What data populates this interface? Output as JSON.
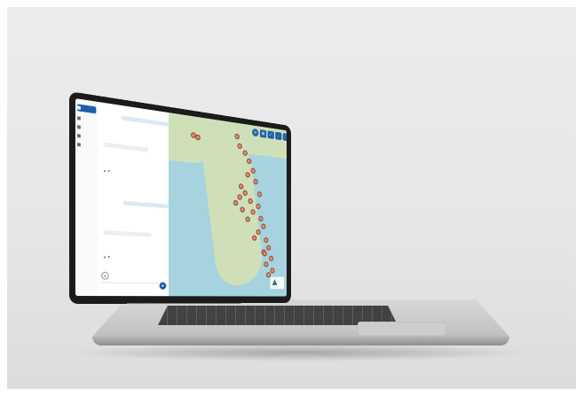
{
  "sidebar": {
    "items": [
      {
        "label": "",
        "icon": "chat-icon",
        "active": true
      },
      {
        "label": "",
        "icon": "history-icon",
        "active": false
      },
      {
        "label": "",
        "icon": "users-icon",
        "active": false
      },
      {
        "label": "",
        "icon": "settings-icon",
        "active": false
      },
      {
        "label": "",
        "icon": "help-icon",
        "active": false
      }
    ]
  },
  "chat": {
    "messages": [
      {
        "role": "user",
        "text": "",
        "time": ""
      },
      {
        "role": "bot",
        "text": "",
        "time": ""
      },
      {
        "role": "user",
        "text": "",
        "time": ""
      },
      {
        "role": "bot",
        "text": "",
        "time": ""
      }
    ],
    "input_placeholder": "",
    "send_icon": "send-icon",
    "mic_icon": "microphone-icon"
  },
  "map": {
    "toolbar_icons": [
      "layers-icon",
      "filter-icon",
      "expand-icon",
      "download-icon",
      "fullscreen-icon"
    ],
    "pin_count": 32,
    "water_color": "#a7d3df",
    "land_color": "#cfe0b8",
    "pin_color": "#e58a6d"
  },
  "colors": {
    "accent": "#1f5fa8"
  }
}
